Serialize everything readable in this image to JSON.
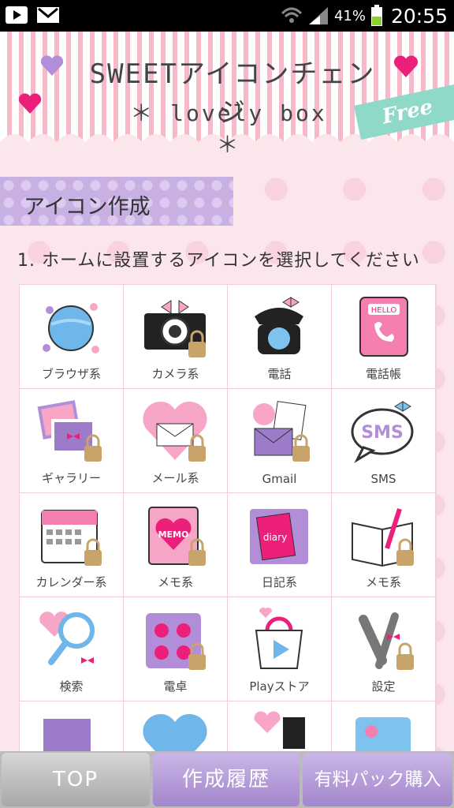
{
  "status_bar": {
    "battery_percent": "41%",
    "time": "20:55"
  },
  "header": {
    "title_line1": "SWEETアイコンチェンジ",
    "title_line2": "＊ lovely box ＊",
    "badge": "Free"
  },
  "section": {
    "title": "アイコン作成",
    "instruction": "1. ホームに設置するアイコンを選択してください"
  },
  "icons": [
    {
      "label": "ブラウザ系",
      "icon": "globe-icon",
      "locked": false
    },
    {
      "label": "カメラ系",
      "icon": "camera-icon",
      "locked": true
    },
    {
      "label": "電話",
      "icon": "telephone-icon",
      "locked": false
    },
    {
      "label": "電話帳",
      "icon": "phonebook-icon",
      "locked": false
    },
    {
      "label": "ギャラリー",
      "icon": "gallery-icon",
      "locked": true
    },
    {
      "label": "メール系",
      "icon": "mail-icon",
      "locked": true
    },
    {
      "label": "Gmail",
      "icon": "gmail-icon",
      "locked": true
    },
    {
      "label": "SMS",
      "icon": "sms-icon",
      "locked": false
    },
    {
      "label": "カレンダー系",
      "icon": "calendar-icon",
      "locked": true
    },
    {
      "label": "メモ系",
      "icon": "memo-icon",
      "locked": true
    },
    {
      "label": "日記系",
      "icon": "diary-icon",
      "locked": false
    },
    {
      "label": "メモ系",
      "icon": "notebook-icon",
      "locked": true
    },
    {
      "label": "検索",
      "icon": "search-icon",
      "locked": false
    },
    {
      "label": "電卓",
      "icon": "calculator-icon",
      "locked": true
    },
    {
      "label": "Playストア",
      "icon": "playstore-icon",
      "locked": false
    },
    {
      "label": "設定",
      "icon": "settings-icon",
      "locked": true
    }
  ],
  "bottom_nav": {
    "top": "TOP",
    "history": "作成履歴",
    "buy": "有料パック購入"
  },
  "colors": {
    "pink": "#f7b8c8",
    "lavender": "#c9b0e3",
    "magenta": "#ec1f7a",
    "mint": "#8fd9c8"
  }
}
